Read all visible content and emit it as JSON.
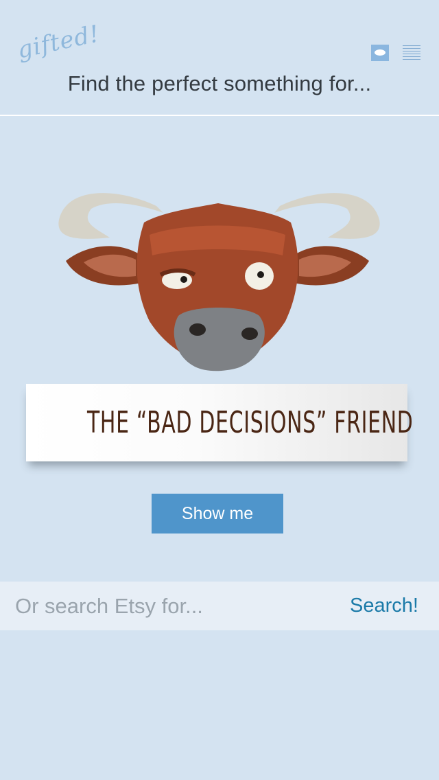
{
  "header": {
    "logo_text": "gifted!",
    "tagline": "Find the perfect something for...",
    "chat_icon": "chat-bubble-icon",
    "menu_icon": "hamburger-menu-icon",
    "accent_color": "#8ab6df"
  },
  "hero": {
    "illustration": "bull-head-illustration",
    "banner_text": "THE “BAD DECISIONS” FRIEND",
    "show_button_label": "Show me",
    "button_color": "#4f95cb"
  },
  "search": {
    "placeholder": "Or search Etsy for...",
    "button_label": "Search!",
    "link_color": "#1b7aa8"
  },
  "theme": {
    "background": "#d4e3f1"
  }
}
